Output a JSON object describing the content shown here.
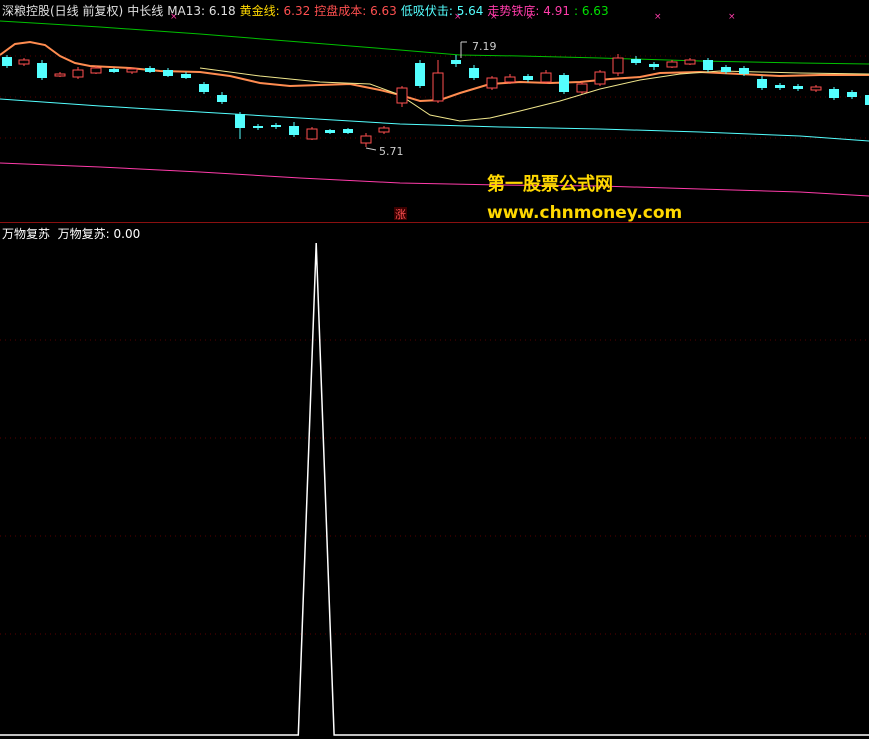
{
  "main_legend": {
    "title": "深粮控股(日线 前复权)",
    "indicator": "中长线",
    "ma13_label": "MA13:",
    "ma13_value": "6.18",
    "gold_label": "黄金线:",
    "gold_value": "6.32",
    "cost_label": "控盘成本:",
    "cost_value": "6.63",
    "low_label": "低吸伏击:",
    "low_value": "5.64",
    "trend_label": "走势铁底:",
    "trend_value": "4.91",
    "extra_value": ": 6.63"
  },
  "annotations": {
    "high_label": "7.19",
    "low_label": "5.71",
    "badge": "涨"
  },
  "watermark": {
    "title": "第一股票公式网",
    "url": "www.chnmoney.com"
  },
  "sub_legend": {
    "name": "万物复苏",
    "series_label": "万物复苏:",
    "series_value": "0.00"
  },
  "colors": {
    "up": "#ff5050",
    "down": "#54ffff",
    "ma13": "#ffffff",
    "gold": "#ffd800",
    "cost": "#ff5050",
    "low": "#54ffff",
    "trend": "#ff3caa",
    "green": "#00c000",
    "orange": "#ff8c50",
    "yellow": "#f0e68c"
  },
  "chart_data": {
    "type": "line",
    "series": [
      {
        "name": "万物复苏",
        "values": [
          0,
          0,
          0,
          0,
          0,
          0,
          0,
          0,
          0,
          0,
          0,
          0,
          0,
          0,
          0,
          0,
          0,
          0,
          1,
          0,
          0,
          0,
          0,
          0,
          0,
          0,
          0,
          0,
          0,
          0,
          0,
          0,
          0,
          0,
          0,
          0,
          0,
          0,
          0,
          0,
          0,
          0,
          0,
          0,
          0,
          0,
          0,
          0,
          0,
          0,
          0,
          0
        ]
      }
    ],
    "ylim": [
      0,
      1
    ]
  }
}
